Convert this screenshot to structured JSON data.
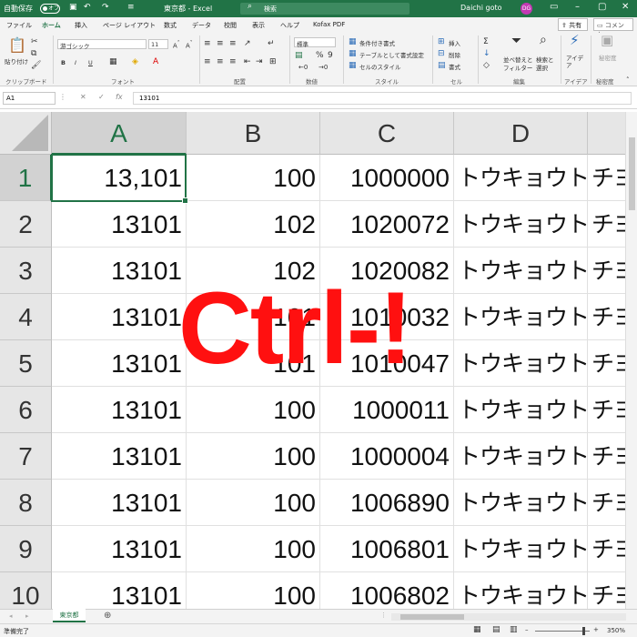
{
  "titlebar": {
    "autosave_label": "自動保存",
    "autosave_state": "オフ",
    "undo_icon": "undo-icon",
    "redo_icon": "redo-icon",
    "save_icon": "save-icon",
    "title": "東京都 - Excel",
    "search_placeholder": "検索",
    "user_name": "Daichi goto",
    "avatar_initials": "DG",
    "brand_color": "#217346"
  },
  "menu": {
    "tabs": [
      "ファイル",
      "ホーム",
      "挿入",
      "ページ レイアウト",
      "数式",
      "データ",
      "校閲",
      "表示",
      "ヘルプ",
      "Kofax PDF"
    ],
    "active_tab": "ホーム",
    "share_label": "共有",
    "comment_label": "コメント"
  },
  "ribbon": {
    "clipboard": {
      "paste": "貼り付け",
      "label": "クリップボード"
    },
    "font": {
      "name": "游ゴシック",
      "size": "11",
      "bold": "B",
      "italic": "I",
      "underline": "U",
      "label": "フォント"
    },
    "alignment": {
      "label": "配置"
    },
    "number": {
      "format": "標準",
      "label": "数値"
    },
    "styles": {
      "conditional": "条件付き書式",
      "table": "テーブルとして書式設定",
      "cell_styles": "セルのスタイル",
      "label": "スタイル"
    },
    "cells": {
      "insert": "挿入",
      "delete": "削除",
      "format": "書式",
      "label": "セル"
    },
    "editing": {
      "sort": "並べ替えと",
      "filter": "フィルター",
      "find": "検索と",
      "select": "選択",
      "label": "編集"
    },
    "ideas": {
      "name": "アイデア",
      "label": "アイデア"
    },
    "sensitivity": {
      "name": "秘密度",
      "label": "秘密度"
    }
  },
  "formula_bar": {
    "name_box": "A1",
    "fx": "fx",
    "formula": "13101"
  },
  "grid": {
    "columns": [
      "A",
      "B",
      "C",
      "D"
    ],
    "rows": [
      {
        "n": "1",
        "a": "13,101",
        "b": "100",
        "c": "1000000",
        "d": "トウキョウト",
        "e": "チヨク"
      },
      {
        "n": "2",
        "a": "13101",
        "b": "102",
        "c": "1020072",
        "d": "トウキョウト",
        "e": "チヨク"
      },
      {
        "n": "3",
        "a": "13101",
        "b": "102",
        "c": "1020082",
        "d": "トウキョウト",
        "e": "チヨク"
      },
      {
        "n": "4",
        "a": "13101",
        "b": "101",
        "c": "1010032",
        "d": "トウキョウト",
        "e": "チヨク"
      },
      {
        "n": "5",
        "a": "13101",
        "b": "101",
        "c": "1010047",
        "d": "トウキョウト",
        "e": "チヨク"
      },
      {
        "n": "6",
        "a": "13101",
        "b": "100",
        "c": "1000011",
        "d": "トウキョウト",
        "e": "チヨク"
      },
      {
        "n": "7",
        "a": "13101",
        "b": "100",
        "c": "1000004",
        "d": "トウキョウト",
        "e": "チヨク"
      },
      {
        "n": "8",
        "a": "13101",
        "b": "100",
        "c": "1006890",
        "d": "トウキョウト",
        "e": "チヨク"
      },
      {
        "n": "9",
        "a": "13101",
        "b": "100",
        "c": "1006801",
        "d": "トウキョウト",
        "e": "チヨク"
      },
      {
        "n": "10",
        "a": "13101",
        "b": "100",
        "c": "1006802",
        "d": "トウキョウト",
        "e": "チヨク"
      }
    ]
  },
  "overlay": {
    "text": "Ctrl-!",
    "color": "#ff1010"
  },
  "sheets": {
    "active": "東京都",
    "add_icon": "plus-icon"
  },
  "status": {
    "ready": "準備完了",
    "zoom": "350%"
  }
}
